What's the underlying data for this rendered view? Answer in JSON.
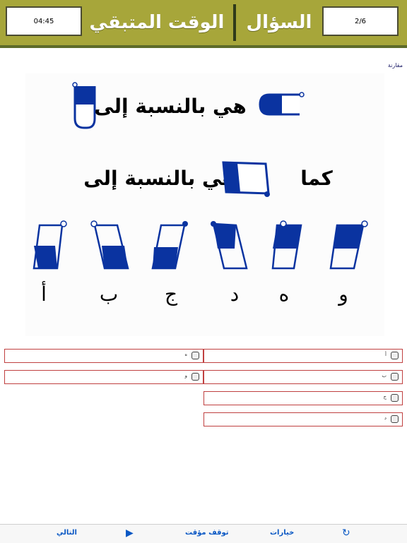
{
  "header": {
    "progress": "2/6",
    "question_title": "السؤال",
    "time_left_title": "الوقت المتبقي",
    "timer": "04:45"
  },
  "question": {
    "type_label": "مقارنة",
    "figure": {
      "row1_text": "هي بالنسبة إلى",
      "row2_kama": "كما",
      "row2_text": "هي بالنسبة إلى",
      "answer_letters": [
        "أ",
        "ب",
        "ج",
        "د",
        "ه",
        "و"
      ]
    }
  },
  "options": [
    {
      "label": "أ"
    },
    {
      "label": "ب"
    },
    {
      "label": "ج"
    },
    {
      "label": "د"
    },
    {
      "label": "ه"
    },
    {
      "label": "و"
    }
  ],
  "footer": {
    "refresh_icon": "refresh-icon",
    "options_label": "خيارات",
    "pause_label": "توقف مؤقت",
    "play_icon": "play-icon",
    "next_label": "التالي"
  },
  "colors": {
    "header_bg": "#a7a63a",
    "accent_blue": "#0a33a0",
    "option_border": "#c04040",
    "footer_text": "#0a58c4"
  }
}
